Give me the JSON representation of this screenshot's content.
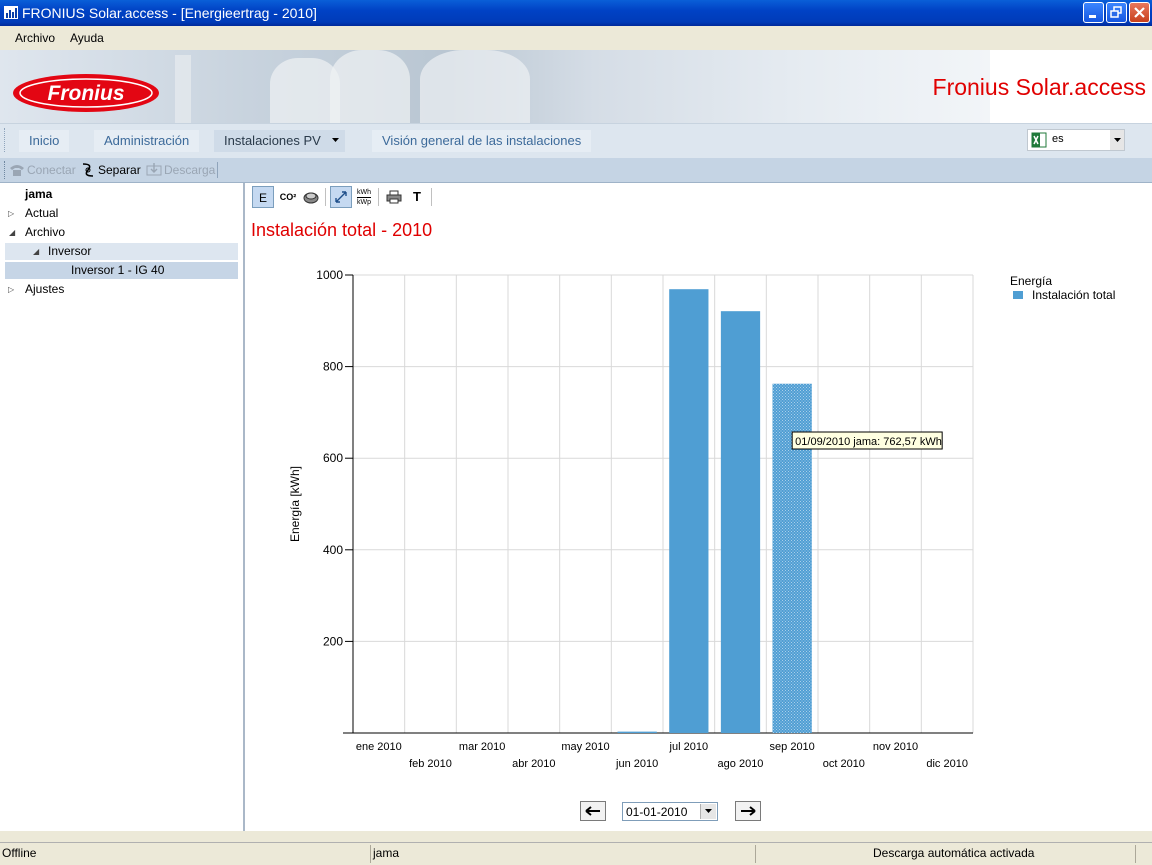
{
  "window": {
    "title": "FRONIUS Solar.access - [Energieertrag - 2010]"
  },
  "menu": {
    "items": [
      "Archivo",
      "Ayuda"
    ]
  },
  "banner": {
    "logo_text": "Fronius",
    "brand": "Fronius Solar.access"
  },
  "nav": {
    "tabs": [
      "Inicio",
      "Administración",
      "Instalaciones PV",
      "Visión general de las instalaciones"
    ],
    "active": "Instalaciones PV",
    "language": "es"
  },
  "toolbar": {
    "connect": "Conectar",
    "separate": "Separar",
    "download": "Descarga"
  },
  "tree": {
    "root": "jama",
    "items": [
      {
        "label": "Actual"
      },
      {
        "label": "Archivo"
      },
      {
        "label": "Inversor"
      },
      {
        "label": "Inversor 1 - IG 40"
      },
      {
        "label": "Ajustes"
      }
    ]
  },
  "chart_tools": {
    "energy": "E",
    "co2": "CO²",
    "kwh_top": "kWh",
    "kwh_bottom": "kWp",
    "text": "T"
  },
  "chart_title": "Instalación total - 2010",
  "chart_data": {
    "type": "bar",
    "title": "Instalación total - 2010",
    "ylabel": "Energía [kWh]",
    "xlabel": "",
    "ylim": [
      0,
      1000
    ],
    "yticks": [
      200,
      400,
      600,
      800,
      1000
    ],
    "grid": true,
    "legend_title": "Energía",
    "legend_placement": "top-right",
    "categories": [
      "ene 2010",
      "feb 2010",
      "mar 2010",
      "abr 2010",
      "may 2010",
      "jun 2010",
      "jul 2010",
      "ago 2010",
      "sep 2010",
      "oct 2010",
      "nov 2010",
      "dic 2010"
    ],
    "series": [
      {
        "name": "Instalación total",
        "color": "#4f9ed3",
        "values": [
          0,
          0,
          0,
          0,
          0,
          3,
          969,
          921,
          762.57,
          0,
          0,
          0
        ]
      }
    ],
    "tooltip": {
      "text": "01/09/2010 jama: 762,57 kWh",
      "category": "sep 2010"
    }
  },
  "date_selector": {
    "value": "01-01-2010"
  },
  "status": {
    "connection": "Offline",
    "user": "jama",
    "auto_download": "Descarga automática activada"
  }
}
